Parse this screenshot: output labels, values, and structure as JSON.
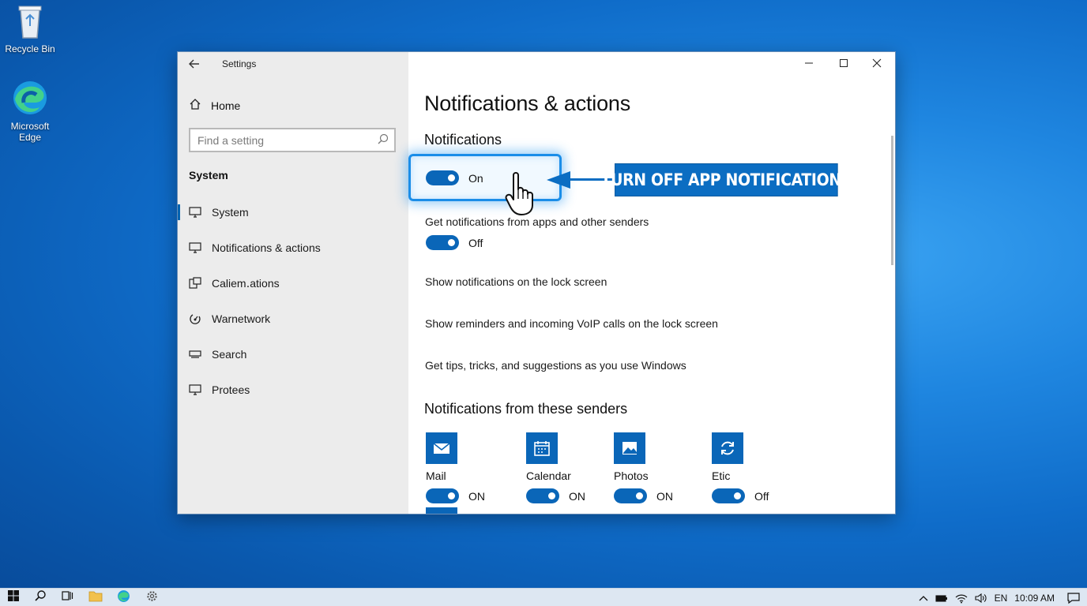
{
  "desktop": {
    "icons": [
      {
        "label": "Recycle Bin",
        "icon": "recycle-bin-icon"
      },
      {
        "label": "Microsoft Edge",
        "icon": "edge-icon"
      }
    ]
  },
  "window": {
    "title": "Settings",
    "controls": {
      "minimize": "minimize-icon",
      "maximize": "maximize-icon",
      "close": "close-icon"
    }
  },
  "sidebar": {
    "home": "Home",
    "search_placeholder": "Find a setting",
    "section": "System",
    "items": [
      {
        "label": "System",
        "icon": "monitor-icon",
        "active": true
      },
      {
        "label": "Notifications & actions",
        "icon": "notification-icon",
        "active": false
      },
      {
        "label": "Caliem․ations",
        "icon": "calendar-icon",
        "active": false
      },
      {
        "label": "Warnetwork",
        "icon": "network-icon",
        "active": false
      },
      {
        "label": "Search",
        "icon": "search-icon",
        "active": false
      },
      {
        "label": "Protees",
        "icon": "monitor-icon",
        "active": false
      }
    ]
  },
  "main": {
    "title": "Notifications & actions",
    "notifications_heading": "Notifications",
    "master_toggle_state": "On",
    "get_notifications_label": "Get notifications from apps and other senders",
    "get_notifications_state": "Off",
    "lock_screen_label": "Show notifications on the lock screen",
    "reminders_label": "Show reminders and incoming VoIP calls on the lock screen",
    "tips_label": "Get tips, tricks, and suggestions as you use Windows",
    "senders_heading": "Notifications from these senders",
    "senders": [
      {
        "name": "Mail",
        "state": "ON",
        "icon": "mail-icon"
      },
      {
        "name": "Calendar",
        "state": "ON",
        "icon": "calendar-icon"
      },
      {
        "name": "Photos",
        "state": "ON",
        "icon": "photos-icon"
      },
      {
        "name": "Etic",
        "state": "Off",
        "icon": "sync-icon"
      }
    ]
  },
  "callout": {
    "text": "TURN OFF APP NOTIFICATIONS",
    "color": "#0b6dc2"
  },
  "taskbar": {
    "language": "EN",
    "time": "10:09 AM"
  },
  "colors": {
    "accent": "#0a66b8",
    "desktop": "#1f86e0"
  }
}
